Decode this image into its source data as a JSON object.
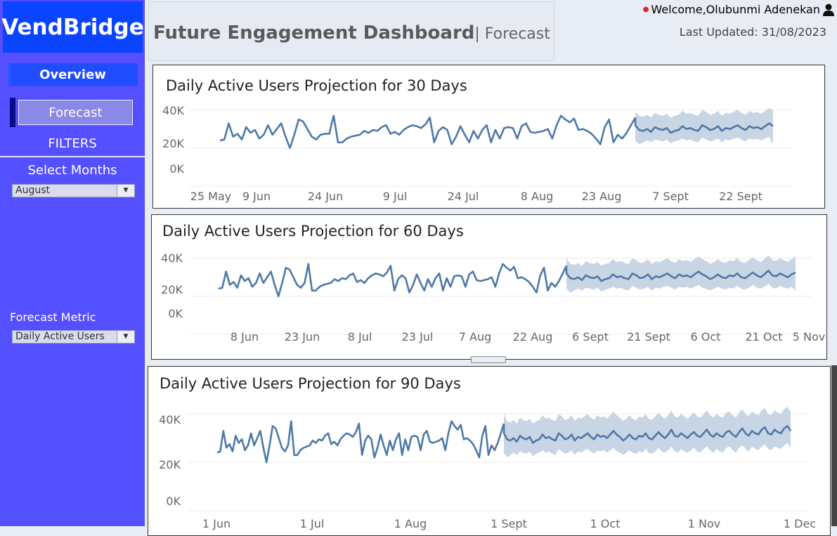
{
  "app": {
    "brand": "VendBridge",
    "welcome": "Welcome,Olubunmi Adenekan",
    "last_updated": "Last Updated: 31/08/2023"
  },
  "header": {
    "title": "Future Engagement Dashboard",
    "subtitle": "| Forecast"
  },
  "sidebar": {
    "overview": "Overview",
    "forecast": "Forecast",
    "filters": "FILTERS",
    "months_label": "Select Months",
    "months_value": "August",
    "metric_label": "Forecast Metric",
    "metric_value": "Daily Active Users"
  },
  "icons": {
    "user": "user-icon",
    "dropdown": "chevron-down-icon"
  },
  "colors": {
    "sidebar": "#5550ff",
    "brand_bg": "#0a44ff",
    "line": "#4e79a7",
    "band": "#c8d5e4"
  },
  "chart_data": [
    {
      "type": "line",
      "title": "Daily Active Users Projection for 30 Days",
      "ylim": [
        0,
        45000
      ],
      "yticks": [
        "40K",
        "20K",
        "0K"
      ],
      "xticks": [
        "25 May",
        "9 Jun",
        "24 Jun",
        "9 Jul",
        "24 Jul",
        "8 Aug",
        "23 Aug",
        "7 Sept",
        "22 Sept"
      ],
      "series": [
        {
          "values": [
            24000,
            24500,
            33000,
            26000,
            27500,
            24500,
            31000,
            28000,
            29500,
            25000,
            27000,
            32000,
            27000,
            30000,
            33000,
            26000,
            20000,
            27000,
            35000,
            34000,
            30000,
            26000,
            24500,
            27000,
            27500,
            27500,
            37000,
            23000,
            23000,
            25000,
            26000,
            26500,
            27000,
            29000,
            28000,
            29500,
            29000,
            31000,
            32000,
            27500,
            28500,
            27000,
            29500,
            31000,
            32000,
            31500,
            30500,
            32500,
            36000,
            23000,
            29000,
            31000,
            29500,
            22000,
            26000,
            31500,
            27000,
            23000,
            29000,
            25000,
            29500,
            32000,
            23000,
            29500,
            25000,
            30500,
            31000,
            30500,
            25000,
            31500,
            33000,
            28500,
            28000,
            28500,
            29000,
            30000,
            25000,
            32000,
            37000,
            35000,
            33500,
            35500,
            29500,
            30000,
            29000,
            27500,
            25000,
            22000,
            31000,
            35000,
            23000,
            27000,
            25000,
            28000,
            32000,
            36000
          ]
        },
        {
          "values": [
            32000,
            29500,
            29000,
            30000,
            28500,
            31000,
            30000,
            29500,
            30500,
            28000,
            29000,
            29500,
            31500,
            30000,
            30500,
            29500,
            29000,
            32000,
            31000,
            29500,
            30000,
            31500,
            29000,
            30500,
            30000,
            31000,
            32000,
            30500,
            29500,
            31500,
            30500,
            31000,
            30000,
            31500,
            33000,
            31500
          ]
        }
      ],
      "band": {
        "lower": [
          24000,
          22000,
          23000,
          24000,
          23000,
          24500,
          24000,
          23500,
          24500,
          22500,
          23500,
          24000,
          25000,
          24000,
          24500,
          23500,
          23000,
          25500,
          24500,
          23500,
          24000,
          25000,
          23000,
          24500,
          24000,
          25000,
          25500,
          24500,
          23500,
          25000,
          24500,
          25000,
          24000,
          25000,
          26000,
          22000
        ],
        "upper": [
          39000,
          37000,
          36500,
          37500,
          36000,
          38500,
          37500,
          37000,
          38000,
          36000,
          37000,
          37500,
          39500,
          38000,
          38500,
          37500,
          37000,
          40000,
          39000,
          37500,
          38000,
          39500,
          37000,
          38500,
          38000,
          39000,
          40000,
          38500,
          37500,
          39500,
          38500,
          39000,
          38000,
          39500,
          41000,
          40000
        ]
      }
    },
    {
      "type": "line",
      "title": "Daily Active Users Projection for 60 Days",
      "ylim": [
        0,
        45000
      ],
      "yticks": [
        "40K",
        "20K",
        "0K"
      ],
      "xticks": [
        "8 Jun",
        "23 Jun",
        "8 Jul",
        "23 Jul",
        "7 Aug",
        "22 Aug",
        "6 Sept",
        "21 Sept",
        "6 Oct",
        "21 Oct",
        "5 Nov"
      ],
      "series": [
        {
          "values": [
            24000,
            24500,
            33000,
            26000,
            27500,
            24500,
            31000,
            28000,
            29500,
            25000,
            27000,
            32000,
            27000,
            30000,
            33000,
            26000,
            20000,
            27000,
            35000,
            34000,
            30000,
            26000,
            24500,
            27000,
            37000,
            23000,
            23000,
            25000,
            26000,
            26500,
            27000,
            29000,
            28000,
            29500,
            29000,
            31000,
            32000,
            27500,
            28500,
            27000,
            29500,
            31000,
            32000,
            31500,
            30500,
            32500,
            36000,
            23000,
            29000,
            31000,
            29500,
            22000,
            26000,
            31500,
            27000,
            23000,
            29000,
            25000,
            29500,
            32000,
            23000,
            29500,
            25000,
            30500,
            31000,
            30500,
            25000,
            31500,
            33000,
            28500,
            28000,
            28500,
            29000,
            30000,
            25000,
            32000,
            37000,
            35000,
            33500,
            35500,
            29500,
            30000,
            29000,
            27500,
            25000,
            22000,
            31000,
            35000,
            23000,
            27000,
            25000,
            28000,
            32000,
            36000
          ]
        },
        {
          "values": [
            32000,
            29500,
            29000,
            30000,
            28500,
            31000,
            30000,
            29500,
            30500,
            28000,
            29000,
            29500,
            31500,
            30000,
            30500,
            29500,
            29000,
            32000,
            31000,
            29500,
            30000,
            31500,
            29000,
            30500,
            30000,
            31000,
            32000,
            30500,
            29500,
            31500,
            30500,
            31000,
            30000,
            31500,
            33000,
            31500,
            30500,
            29000,
            30000,
            31500,
            30000,
            29500,
            31000,
            30500,
            32000,
            30000,
            29500,
            31000,
            32500,
            31000,
            30000,
            31500,
            33500,
            31000,
            30500,
            32000,
            31000,
            30000,
            31500,
            32500
          ]
        }
      ],
      "band": {
        "lower": [
          24000,
          22000,
          23000,
          24000,
          23000,
          24500,
          24000,
          23500,
          24500,
          22500,
          23500,
          24000,
          25000,
          24000,
          24500,
          23500,
          23000,
          25500,
          24500,
          23500,
          24000,
          25000,
          23000,
          24500,
          24000,
          25000,
          25500,
          24500,
          23500,
          25000,
          24500,
          25000,
          24000,
          25000,
          26000,
          24500,
          24000,
          23000,
          24000,
          25000,
          24000,
          23500,
          24500,
          24000,
          25500,
          24000,
          23500,
          24500,
          26000,
          24500,
          24000,
          25000,
          26500,
          24500,
          24000,
          25500,
          24500,
          24000,
          25000,
          23000
        ],
        "upper": [
          40000,
          37000,
          36500,
          37500,
          36000,
          38500,
          37500,
          37000,
          38000,
          36000,
          37000,
          37500,
          39500,
          38000,
          38500,
          37500,
          37000,
          40000,
          39000,
          37500,
          38000,
          39500,
          37000,
          38500,
          38000,
          39000,
          40000,
          38500,
          37500,
          39500,
          38500,
          39000,
          38000,
          39500,
          41000,
          39500,
          38500,
          37000,
          38000,
          39500,
          38000,
          37500,
          39000,
          38500,
          40000,
          38000,
          37500,
          39000,
          40500,
          39000,
          38000,
          39500,
          41500,
          39000,
          38500,
          40000,
          39000,
          38000,
          39500,
          41000
        ]
      }
    },
    {
      "type": "line",
      "title": "Daily Active Users Projection for 90 Days",
      "ylim": [
        0,
        45000
      ],
      "yticks": [
        "40K",
        "20K",
        "0K"
      ],
      "xticks": [
        "1 Jun",
        "1 Jul",
        "1 Aug",
        "1 Sept",
        "1 Oct",
        "1 Nov",
        "1 Dec"
      ],
      "series": [
        {
          "values": [
            24000,
            24500,
            33000,
            26000,
            27500,
            24500,
            31000,
            28000,
            29500,
            25000,
            27000,
            32000,
            27000,
            30000,
            33000,
            26000,
            20000,
            27000,
            35000,
            34000,
            30000,
            26000,
            24500,
            27000,
            37000,
            23000,
            23000,
            25000,
            26000,
            26500,
            27000,
            29000,
            28000,
            29500,
            29000,
            31000,
            32000,
            27500,
            28500,
            27000,
            29500,
            31000,
            32000,
            31500,
            30500,
            32500,
            36000,
            23000,
            29000,
            31000,
            29500,
            22000,
            26000,
            31500,
            27000,
            23000,
            29000,
            25000,
            29500,
            32000,
            23000,
            29500,
            25000,
            30500,
            31000,
            30500,
            25000,
            31500,
            33000,
            28500,
            28000,
            28500,
            29000,
            30000,
            25000,
            32000,
            37000,
            35000,
            33500,
            35500,
            29500,
            30000,
            29000,
            27500,
            25000,
            22000,
            31000,
            35000,
            23000,
            27000,
            25000,
            28000,
            32000,
            36000
          ]
        },
        {
          "values": [
            32000,
            29500,
            29000,
            30000,
            28500,
            31000,
            30000,
            29500,
            30500,
            28000,
            29000,
            29500,
            31500,
            30000,
            30500,
            29500,
            29000,
            32000,
            31000,
            29500,
            30000,
            31500,
            29000,
            30500,
            30000,
            31000,
            32000,
            30500,
            29500,
            31500,
            30500,
            31000,
            30000,
            31500,
            33000,
            31500,
            30500,
            29000,
            30000,
            31500,
            30000,
            29500,
            31000,
            30500,
            32000,
            30000,
            29500,
            31000,
            32500,
            31000,
            30000,
            31500,
            33500,
            31000,
            30500,
            32000,
            31000,
            30000,
            31500,
            32500,
            31000,
            30500,
            32000,
            33500,
            31500,
            30500,
            32000,
            31000,
            30500,
            32500,
            33000,
            31500,
            30500,
            32500,
            34000,
            32000,
            31000,
            33000,
            32000,
            31500,
            33500,
            34500,
            32000,
            31500,
            33500,
            32500,
            32000,
            34000,
            35000,
            33000
          ]
        }
      ],
      "band": {
        "lower": [
          24000,
          22000,
          23000,
          24000,
          23000,
          24500,
          24000,
          23500,
          24500,
          22500,
          23500,
          24000,
          25000,
          24000,
          24500,
          23500,
          23000,
          25500,
          24500,
          23500,
          24000,
          25000,
          23000,
          24500,
          24000,
          25000,
          25500,
          24500,
          23500,
          25000,
          24500,
          25000,
          24000,
          25000,
          26000,
          24500,
          24000,
          23000,
          24000,
          25000,
          24000,
          23500,
          24500,
          24000,
          25500,
          24000,
          23500,
          24500,
          26000,
          24500,
          24000,
          25000,
          26500,
          24500,
          24000,
          25500,
          24500,
          24000,
          25000,
          26000,
          24500,
          24000,
          25500,
          26500,
          25000,
          24000,
          25500,
          24500,
          24000,
          26000,
          26500,
          25000,
          24000,
          26000,
          27000,
          25500,
          24500,
          26500,
          25500,
          25000,
          26500,
          27500,
          25500,
          25000,
          26500,
          26000,
          25500,
          27000,
          28000,
          26000
        ],
        "upper": [
          40000,
          37000,
          36500,
          37500,
          36000,
          38500,
          37500,
          37000,
          38000,
          36000,
          37000,
          37500,
          39500,
          38000,
          38500,
          37500,
          37000,
          40000,
          39000,
          37500,
          38000,
          39500,
          37000,
          38500,
          38000,
          39000,
          40000,
          38500,
          37500,
          39500,
          38500,
          39000,
          38000,
          39500,
          41000,
          39500,
          38500,
          37000,
          38000,
          39500,
          38000,
          37500,
          39000,
          38500,
          40000,
          38000,
          37500,
          39000,
          40500,
          39000,
          38000,
          39500,
          41500,
          39000,
          38500,
          40000,
          39000,
          38000,
          39500,
          40500,
          39000,
          38500,
          40000,
          41500,
          39500,
          38500,
          40000,
          39000,
          38500,
          40500,
          41000,
          39500,
          38500,
          40500,
          42000,
          40000,
          39000,
          41000,
          40000,
          39500,
          41500,
          42500,
          40000,
          39500,
          41500,
          40500,
          40000,
          42000,
          43000,
          41000
        ]
      }
    }
  ]
}
